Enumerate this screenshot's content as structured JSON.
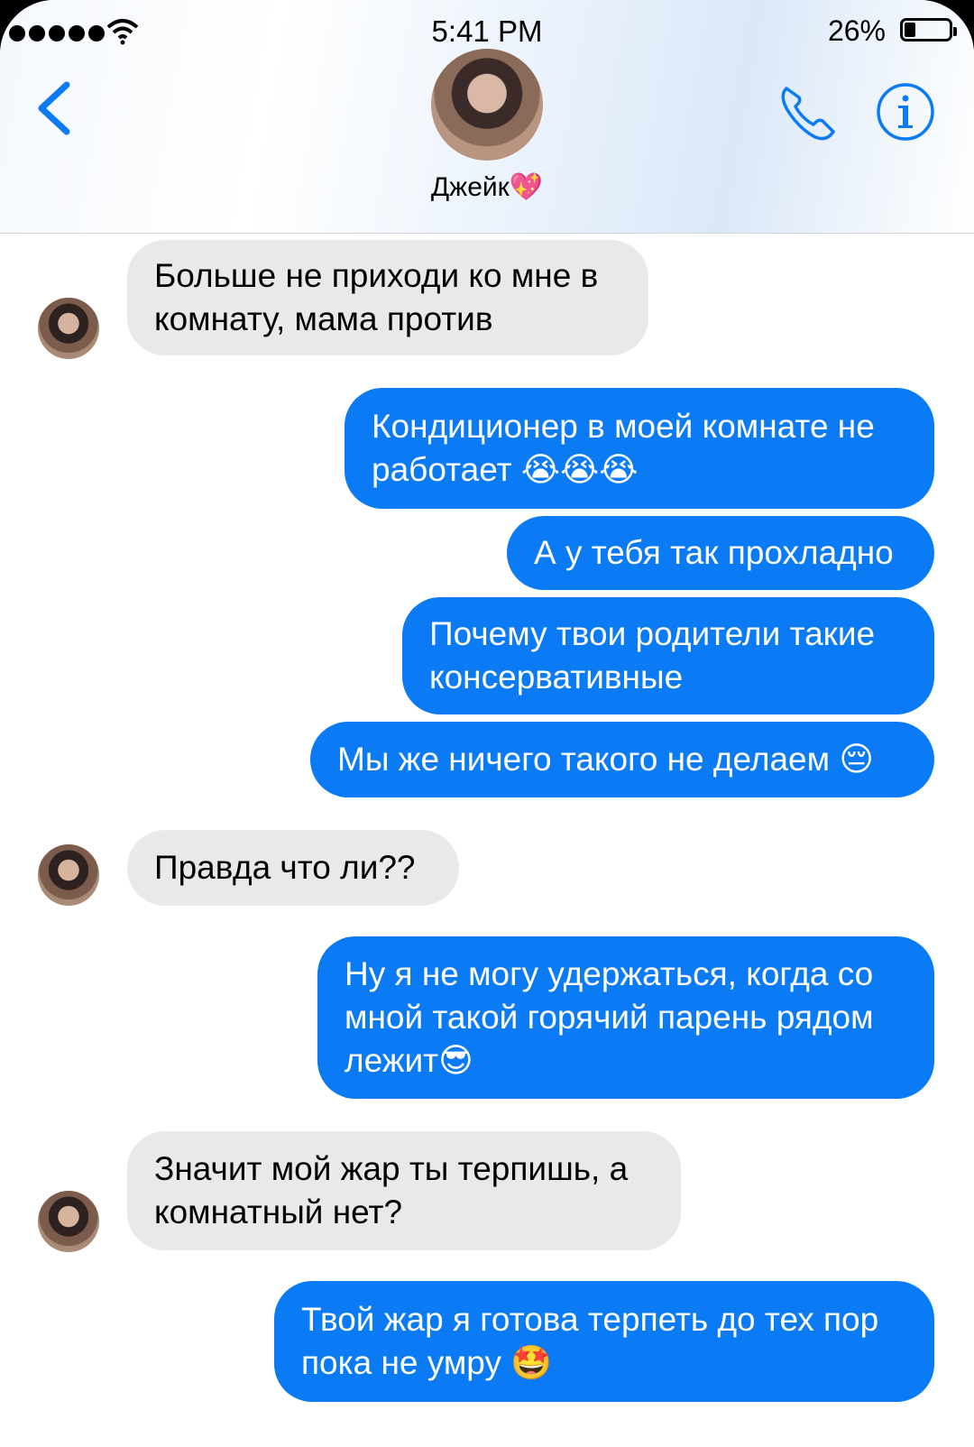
{
  "status_bar": {
    "time": "5:41 PM",
    "battery_percent": "26%",
    "battery_level": 0.26,
    "signal_bars": 5,
    "signal_icon": "signal-dots-icon",
    "wifi_icon": "wifi-icon"
  },
  "header": {
    "contact_name": "Джейк💖",
    "back_icon": "chevron-left-icon",
    "call_icon": "phone-icon",
    "info_icon": "info-icon",
    "accent_color": "#0a7bf5"
  },
  "messages": [
    {
      "from": "them",
      "text": "Больше не приходи ко мне в комнату, мама против"
    },
    {
      "from": "me",
      "text": "Кондиционер в моей комнате не работает 😭😭😭"
    },
    {
      "from": "me",
      "text": "А у тебя так прохладно"
    },
    {
      "from": "me",
      "text": "Почему твои родители такие консервативные"
    },
    {
      "from": "me",
      "text": "Мы же ничего такого не делаем 😔"
    },
    {
      "from": "them",
      "text": "Правда что ли??"
    },
    {
      "from": "me",
      "text": "Ну я не могу удержаться, когда со мной такой горячий парень рядом лежит😎"
    },
    {
      "from": "them",
      "text": "Значит мой жар ты терпишь, а комнатный нет?"
    },
    {
      "from": "me",
      "text": "Твой жар я готова терпеть до тех пор пока не умру 🤩"
    }
  ],
  "colors": {
    "outgoing_bubble": "#0a7bf5",
    "incoming_bubble": "#e9e9eb"
  }
}
